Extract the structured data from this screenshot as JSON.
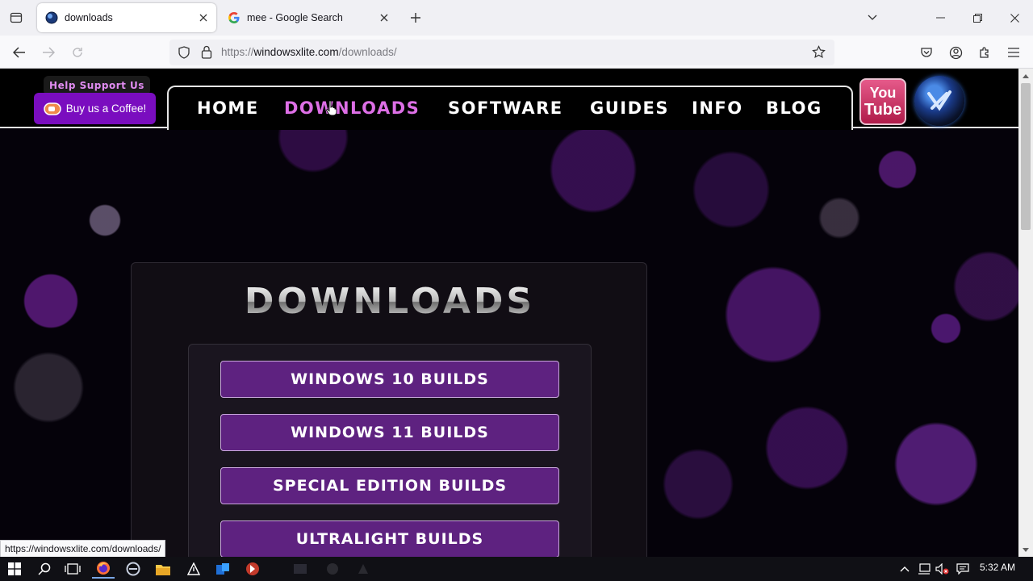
{
  "browser": {
    "tabs": [
      {
        "title": "downloads",
        "active": true
      },
      {
        "title": "mee - Google Search",
        "active": false
      }
    ],
    "url": {
      "scheme": "https://",
      "host": "windowsxlite.com",
      "path": "/downloads/"
    },
    "status_url": "https://windowsxlite.com/downloads/"
  },
  "site": {
    "support_label": "Help Support Us",
    "coffee_label": "Buy us a Coffee!",
    "menu": [
      "HOME",
      "DOWNLOADS",
      "SOFTWARE",
      "GUIDES",
      "INFO",
      "BLOG"
    ],
    "current_menu": "DOWNLOADS",
    "youtube": {
      "line1": "You",
      "line2": "Tube"
    },
    "downloads_title": "DOWNLOADS",
    "build_buttons": [
      "WINDOWS 10 BUILDS",
      "WINDOWS 11 BUILDS",
      "SPECIAL EDITION BUILDS",
      "ULTRALIGHT BUILDS"
    ]
  },
  "taskbar": {
    "time": "5:32 AM"
  },
  "colors": {
    "accent_purple": "#5e2280",
    "menu_active": "#dd6fe6",
    "coffee_button": "#7a0dbf"
  }
}
